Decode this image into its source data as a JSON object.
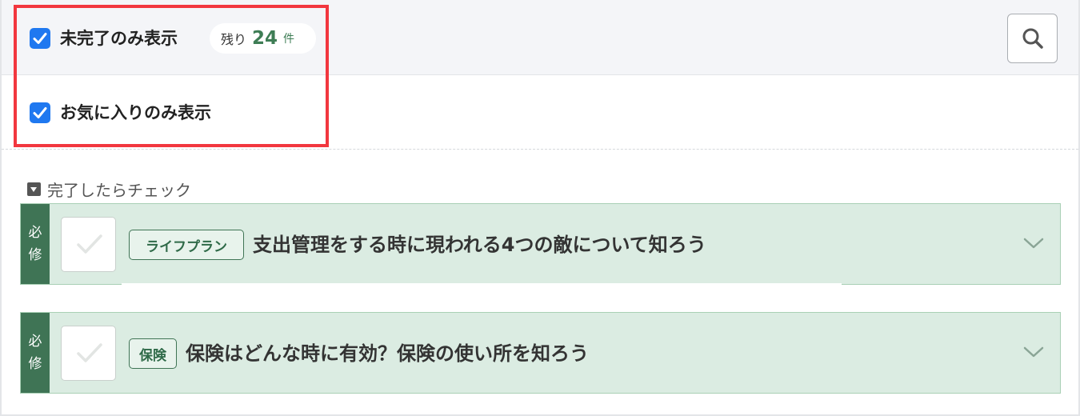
{
  "filters": {
    "incomplete_only": {
      "label": "未完了のみ表示",
      "checked": true
    },
    "remaining": {
      "prefix": "残り",
      "count": "24",
      "unit": "件"
    },
    "favorites_only": {
      "label": "お気に入りのみ表示",
      "checked": true
    }
  },
  "search": {
    "icon": "search-icon"
  },
  "section": {
    "title": "完了したらチェック"
  },
  "courses": [
    {
      "required_line1": "必",
      "required_line2": "修",
      "category": "ライフプラン",
      "title": "支出管理をする時に現われる4つの敵について知ろう"
    },
    {
      "required_line1": "必",
      "required_line2": "修",
      "category": "保険",
      "title": "保険はどんな時に有効？保険の使い所を知ろう"
    }
  ],
  "colors": {
    "accent_green": "#3f7455",
    "card_bg": "#dbece2",
    "checkbox_blue": "#1f78f0",
    "highlight_red": "#f2373f"
  }
}
